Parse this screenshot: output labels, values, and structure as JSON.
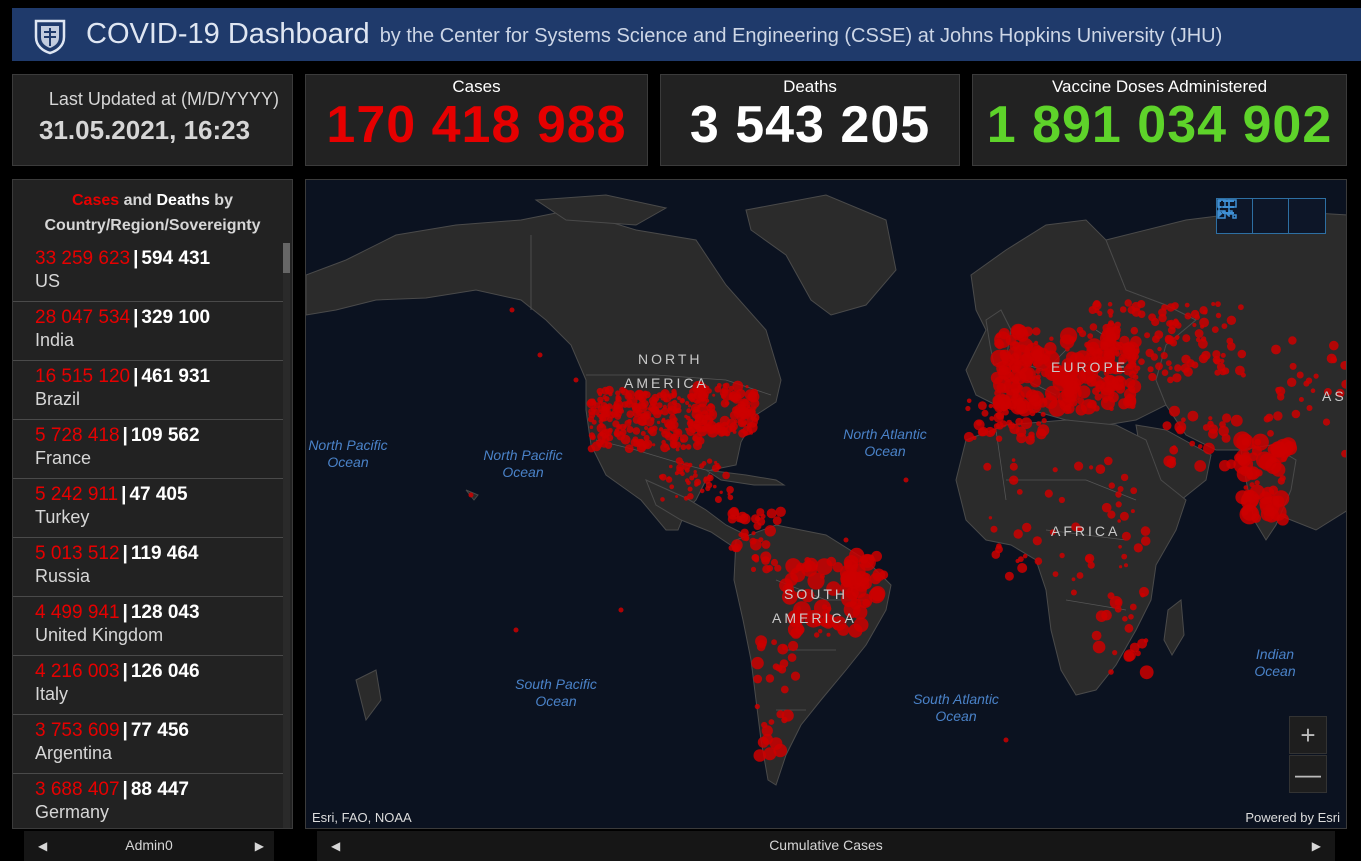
{
  "header": {
    "title": "COVID-19 Dashboard",
    "subtitle": "by the Center for Systems Science and Engineering (CSSE) at Johns Hopkins University (JHU)",
    "logo_icon": "jhu-shield-icon"
  },
  "last_updated": {
    "label": "Last Updated at (M/D/YYYY)",
    "value": "31.05.2021, 16:23"
  },
  "stats": {
    "cases": {
      "label": "Cases",
      "value": "170 418 988",
      "color": "#e60000"
    },
    "deaths": {
      "label": "Deaths",
      "value": "3 543 205",
      "color": "#ffffff"
    },
    "vaccine": {
      "label": "Vaccine Doses Administered",
      "value": "1 891 034 902",
      "color": "#5ed32a"
    }
  },
  "country_list": {
    "title_cases": "Cases",
    "title_and": " and ",
    "title_deaths": "Deaths",
    "title_rest_1": " by",
    "title_rest_2": "Country/Region/Sovereignty",
    "rows": [
      {
        "cases": "33 259 623",
        "deaths": "594 431",
        "name": "US"
      },
      {
        "cases": "28 047 534",
        "deaths": "329 100",
        "name": "India"
      },
      {
        "cases": "16 515 120",
        "deaths": "461 931",
        "name": "Brazil"
      },
      {
        "cases": "5 728 418",
        "deaths": "109 562",
        "name": "France"
      },
      {
        "cases": "5 242 911",
        "deaths": "47 405",
        "name": "Turkey"
      },
      {
        "cases": "5 013 512",
        "deaths": "119 464",
        "name": "Russia"
      },
      {
        "cases": "4 499 941",
        "deaths": "128 043",
        "name": "United Kingdom"
      },
      {
        "cases": "4 216 003",
        "deaths": "126 046",
        "name": "Italy"
      },
      {
        "cases": "3 753 609",
        "deaths": "77 456",
        "name": "Argentina"
      },
      {
        "cases": "3 688 407",
        "deaths": "88 447",
        "name": "Germany"
      }
    ],
    "separator": "|"
  },
  "map": {
    "labels": {
      "north_america_1": "NORTH",
      "north_america_2": "AMERICA",
      "south_america_1": "SOUTH",
      "south_america_2": "AMERICA",
      "europe": "EUROPE",
      "africa": "AFRICA",
      "asia": "ASI",
      "np_ocean_w_1": "North Pacific",
      "np_ocean_w_2": "Ocean",
      "np_ocean_1": "North Pacific",
      "np_ocean_2": "Ocean",
      "na_ocean_1": "North Atlantic",
      "na_ocean_2": "Ocean",
      "sp_ocean_1": "South Pacific",
      "sp_ocean_2": "Ocean",
      "sa_ocean_1": "South Atlantic",
      "sa_ocean_2": "Ocean",
      "in_ocean_1": "Indian",
      "in_ocean_2": "Ocean"
    },
    "attribution_left": "Esri, FAO, NOAA",
    "attribution_right": "Powered by Esri",
    "tools": [
      "bookmark-icon",
      "legend-list-icon",
      "qr-code-icon"
    ],
    "zoom_in": "+",
    "zoom_out": "—",
    "marker_color": "#cc0000"
  },
  "footer": {
    "left_label": "Admin0",
    "right_label": "Cumulative Cases",
    "prev_arrow": "◀",
    "next_arrow": "▶"
  }
}
